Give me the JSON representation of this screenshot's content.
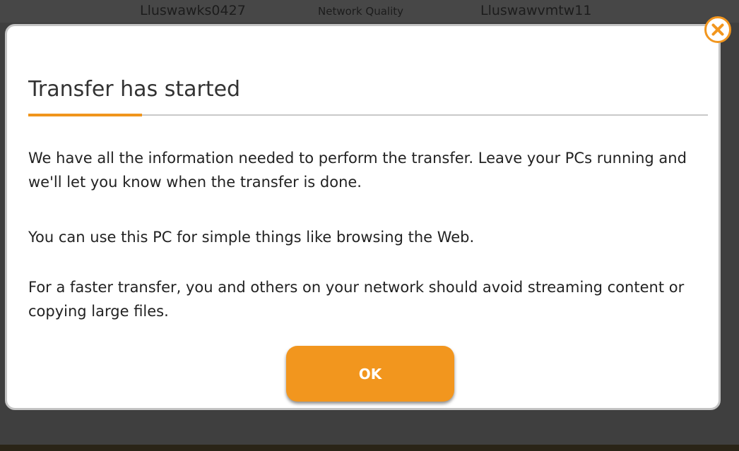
{
  "background": {
    "columns": [
      "Lluswawks0427",
      "Network Quality",
      "Lluswawvmtw11"
    ]
  },
  "dialog": {
    "title": "Transfer has started",
    "paragraphs": [
      "We have all the information needed to perform the transfer. Leave your PCs running and we'll let you know when the transfer is done.",
      "You can use this PC for simple things like browsing the Web.",
      "For a faster transfer, you and others on your network should avoid streaming content or copying large files."
    ],
    "ok_label": "OK",
    "close_icon": "close-circle-x-icon"
  },
  "colors": {
    "accent": "#f2961e",
    "backdrop": "#3f3f3f",
    "dialog_bg": "#ffffff"
  }
}
